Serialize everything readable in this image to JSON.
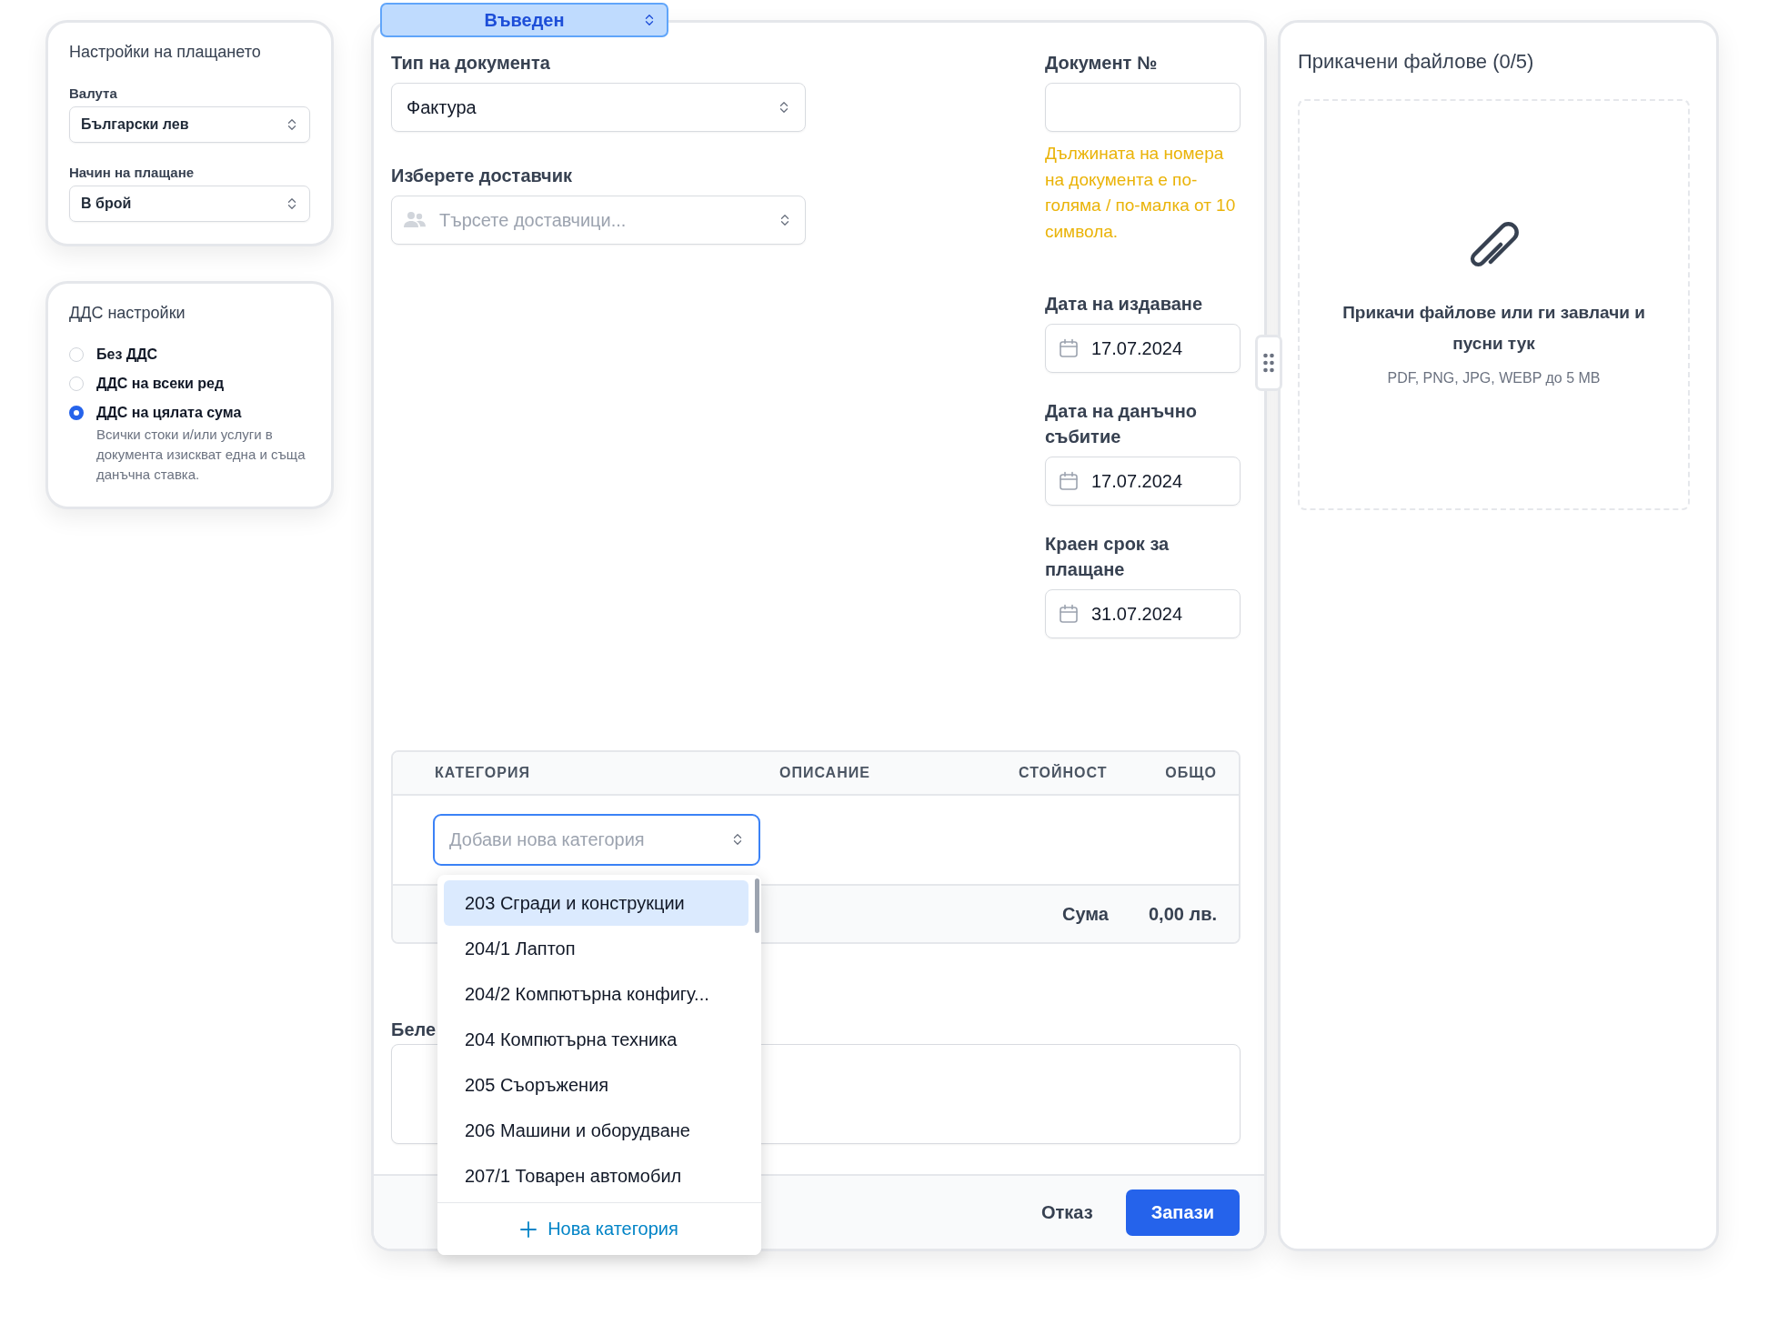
{
  "payment_settings": {
    "title": "Настройки на плащането",
    "fields": [
      {
        "label": "Валута",
        "value": "Български лев"
      },
      {
        "label": "Начин на плащане",
        "value": "В брой"
      }
    ]
  },
  "vat_settings": {
    "title": "ДДС настройки",
    "options": [
      {
        "label": "Без ДДС",
        "selected": false
      },
      {
        "label": "ДДС на всеки ред",
        "selected": false
      },
      {
        "label": "ДДС на цялата сума",
        "selected": true,
        "description": "Всички стоки и/или услуги в документа изискват една и съща данъчна ставка."
      }
    ]
  },
  "document": {
    "status": "Въведен",
    "document_type": {
      "label": "Тип на документа",
      "value": "Фактура"
    },
    "supplier": {
      "label": "Изберете доставчик",
      "placeholder": "Търсете доставчици..."
    },
    "document_number": {
      "label": "Документ №",
      "warning": "Дължината на номера на документа е по-голяма / по-малка от 10 символа."
    },
    "dates": [
      {
        "label": "Дата на издаване",
        "value": "17.07.2024"
      },
      {
        "label": "Дата на данъчно събитие",
        "value": "17.07.2024"
      },
      {
        "label": "Краен срок за плащане",
        "value": "31.07.2024"
      }
    ],
    "table": {
      "columns": [
        "КАТЕГОРИЯ",
        "ОПИСАНИЕ",
        "СТОЙНОСТ",
        "ОБЩО"
      ],
      "category_field": {
        "placeholder": "Добави нова категория"
      },
      "total_label": "Сума",
      "total_value": "0,00 лв."
    },
    "category_menu": {
      "items": [
        {
          "label": "203 Сгради и конструкции",
          "selected": true
        },
        {
          "label": "204/1 Лаптоп",
          "selected": false
        },
        {
          "label": "204/2 Компютърна конфигу...",
          "selected": false
        },
        {
          "label": "204 Компютърна техника",
          "selected": false
        },
        {
          "label": "205 Съоръжения",
          "selected": false
        },
        {
          "label": "206 Машини и оборудване",
          "selected": false
        },
        {
          "label": "207/1 Товарен автомобил",
          "selected": false
        }
      ],
      "add_label": "Нова категория"
    },
    "notes": {
      "label": "Беле"
    },
    "buttons": {
      "cancel": "Отказ",
      "save": "Запази"
    }
  },
  "attachments": {
    "title": "Прикачени файлове (0/5)",
    "drop_title": "Прикачи файлове или ги завлачи и пусни тук",
    "drop_hint": "PDF, PNG, JPG, WEBP до 5 MB"
  }
}
